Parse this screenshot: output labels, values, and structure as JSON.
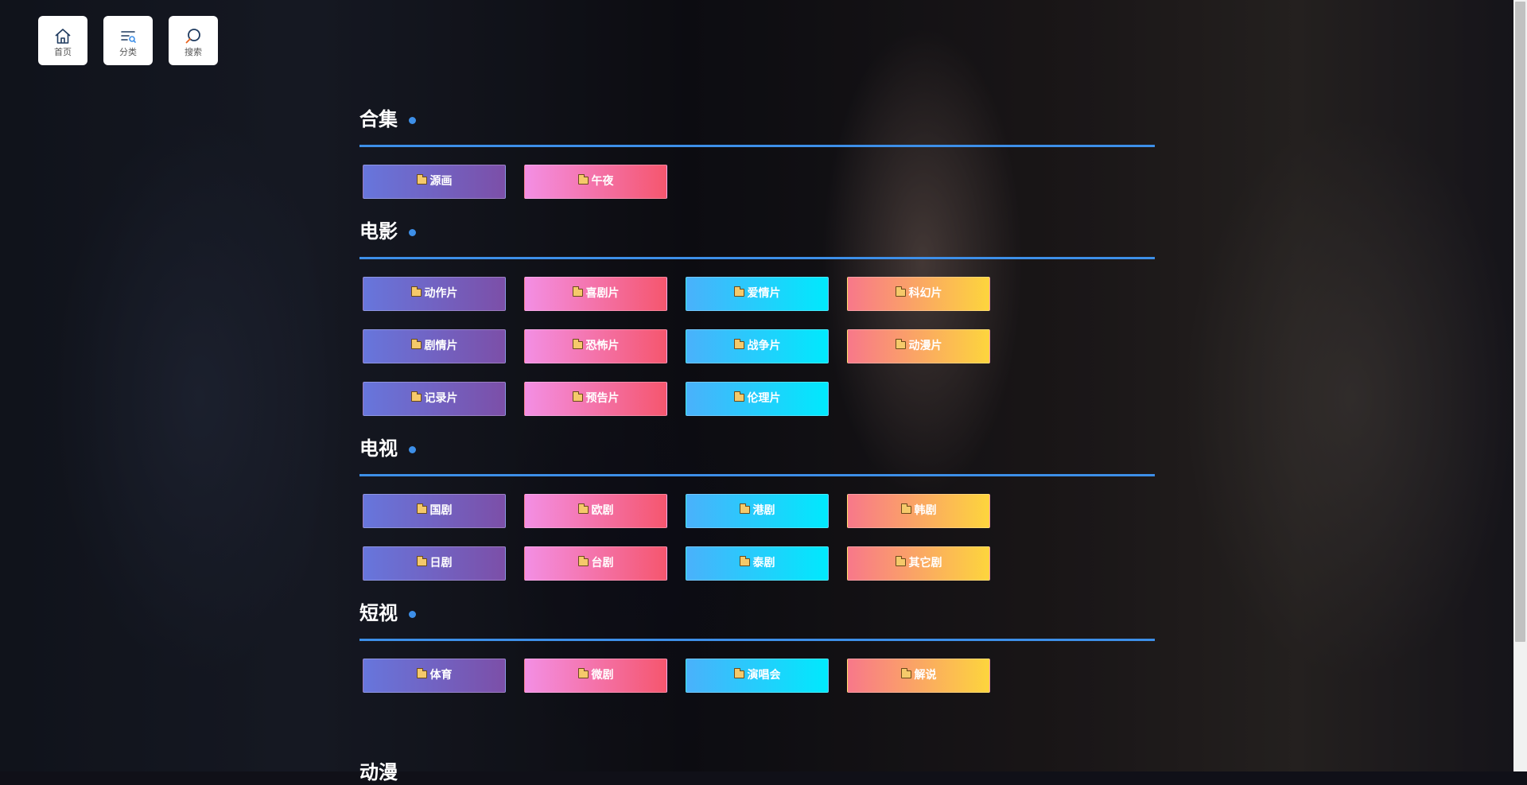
{
  "nav": {
    "home_label": "首页",
    "category_label": "分类",
    "search_label": "搜索"
  },
  "sections": [
    {
      "title": "合集",
      "tags": [
        "源画",
        "午夜"
      ]
    },
    {
      "title": "电影",
      "tags": [
        "动作片",
        "喜剧片",
        "爱情片",
        "科幻片",
        "剧情片",
        "恐怖片",
        "战争片",
        "动漫片",
        "记录片",
        "预告片",
        "伦理片"
      ]
    },
    {
      "title": "电视",
      "tags": [
        "国剧",
        "欧剧",
        "港剧",
        "韩剧",
        "日剧",
        "台剧",
        "泰剧",
        "其它剧"
      ]
    },
    {
      "title": "短视",
      "tags": [
        "体育",
        "微剧",
        "演唱会",
        "解说"
      ]
    }
  ],
  "partial_section_title": "动漫",
  "colors": {
    "accent": "#3d8fe8",
    "gradients": [
      [
        "#6776dc",
        "#7c4fa8"
      ],
      [
        "#f38fe4",
        "#f5566e"
      ],
      [
        "#4ab1fb",
        "#00e9fd"
      ],
      [
        "#f8788a",
        "#fdd53d"
      ]
    ]
  },
  "icons": {
    "home": "home-icon",
    "category": "list-filter-icon",
    "search": "search-icon",
    "tag": "folder-icon"
  }
}
